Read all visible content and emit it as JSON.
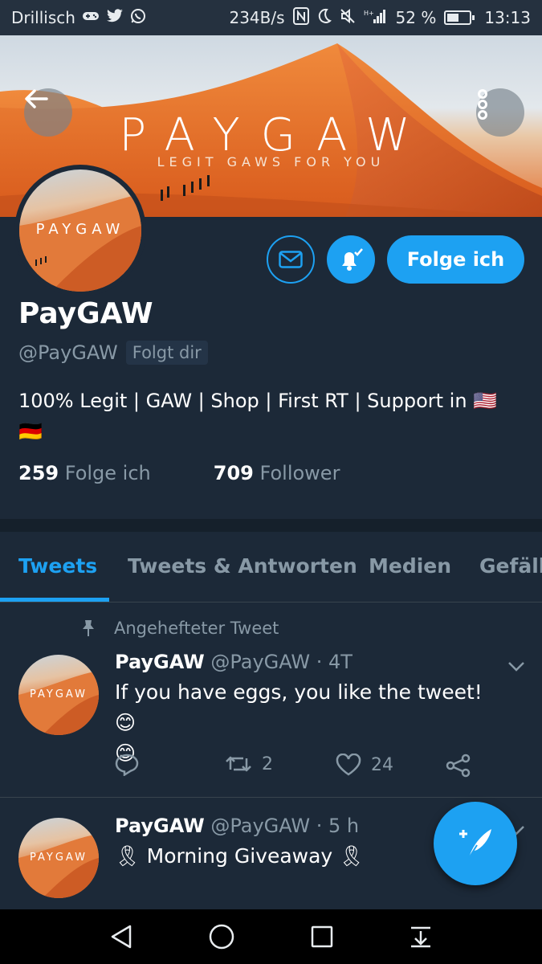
{
  "status_bar": {
    "carrier": "Drillisch",
    "speed": "234B/s",
    "battery": "52 %",
    "battery_level": 0.52,
    "time": "13:13"
  },
  "banner": {
    "title": "PAYGAW",
    "subtitle": "LEGIT GAWS FOR YOU"
  },
  "avatar": {
    "text": "PAYGAW"
  },
  "profile": {
    "name": "PayGAW",
    "handle": "@PayGAW",
    "follows_you": "Folgt dir",
    "bio_line1": "100% Legit | GAW | Shop | First RT | Support in 🇺🇸",
    "bio_line2": "🇩🇪",
    "following_count": "259",
    "following_label": "Folge ich",
    "followers_count": "709",
    "followers_label": "Follower",
    "follow_button": "Folge ich"
  },
  "tabs": [
    {
      "label": "Tweets",
      "active": true
    },
    {
      "label": "Tweets & Antworten",
      "active": false
    },
    {
      "label": "Medien",
      "active": false
    },
    {
      "label": "Gefällt",
      "active": false
    }
  ],
  "tweets": [
    {
      "pinned_label": "Angehefteter Tweet",
      "author": "PayGAW",
      "handle": "@PayGAW",
      "time": "· 4T",
      "text_line1": "If you have eggs, you like the tweet!😊",
      "text_line2": "😊",
      "retweets": "2",
      "likes": "24"
    },
    {
      "author": "PayGAW",
      "handle": "@PayGAW",
      "time": "· 5 h",
      "text_line1": "🎗 Morning Giveaway 🎗"
    }
  ],
  "colors": {
    "background": "#1c2938",
    "accent": "#1da1f2",
    "muted": "#8899a6"
  }
}
